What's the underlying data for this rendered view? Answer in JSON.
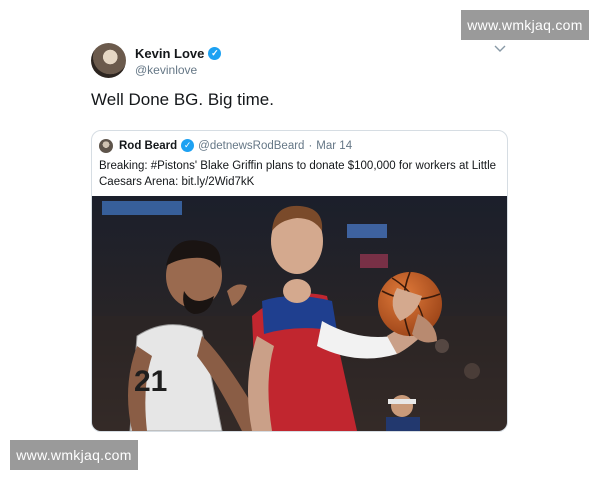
{
  "watermark": {
    "text": "www.wmkjaq.com"
  },
  "tweet": {
    "author_name": "Kevin Love",
    "author_handle": "@kevinlove",
    "text": "Well Done BG. Big time.",
    "verified_icon": "verified-badge-icon",
    "menu_icon": "chevron-down-icon"
  },
  "quoted_tweet": {
    "author_name": "Rod Beard",
    "author_handle": "@detnewsRodBeard",
    "separator": "·",
    "date": "Mar 14",
    "text": "Breaking: #Pistons' Blake Griffin plans to donate $100,000 for workers at Little Caesars Arena: bit.ly/2Wid7kK",
    "jersey_text": "21"
  },
  "colors": {
    "verified": "#1da1f2",
    "handle": "#657786",
    "watermark_bg": "#9a9a9a"
  }
}
